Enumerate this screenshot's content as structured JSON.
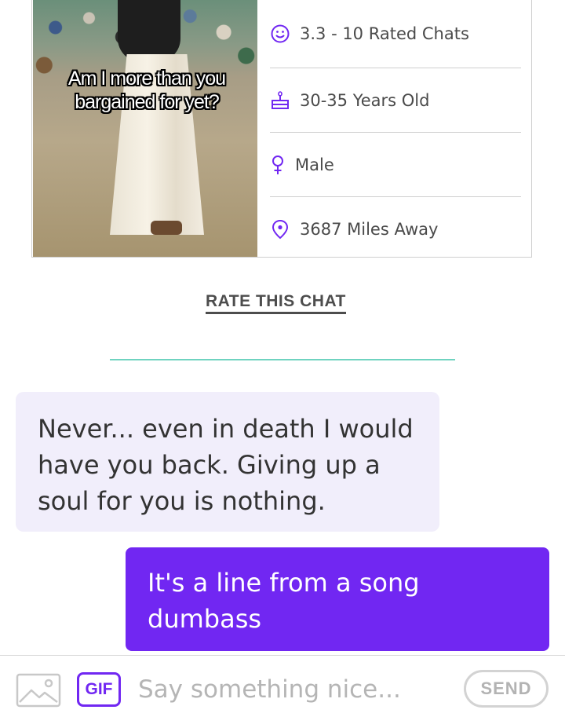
{
  "profile": {
    "photo_caption": "Am I more than you bargained for yet?",
    "stats": [
      {
        "icon": "smiley-icon",
        "label": "3.3 - 10 Rated Chats"
      },
      {
        "icon": "cake-icon",
        "label": "30-35 Years Old"
      },
      {
        "icon": "gender-icon",
        "label": "Male"
      },
      {
        "icon": "location-pin-icon",
        "label": "3687 Miles Away"
      }
    ]
  },
  "rate_link": "RATE THIS CHAT",
  "messages": [
    {
      "direction": "incoming",
      "text": "Never... even in death I would have you back. Giving up a soul for you is nothing."
    },
    {
      "direction": "outgoing",
      "text": "It's a line from a song dumbass"
    }
  ],
  "composer": {
    "image_icon": "image-icon",
    "gif_label": "GIF",
    "placeholder": "Say something nice...",
    "send_label": "SEND"
  },
  "colors": {
    "accent": "#7127f2",
    "incoming_bubble": "#f1eefb",
    "divider": "#6fd3c0"
  }
}
